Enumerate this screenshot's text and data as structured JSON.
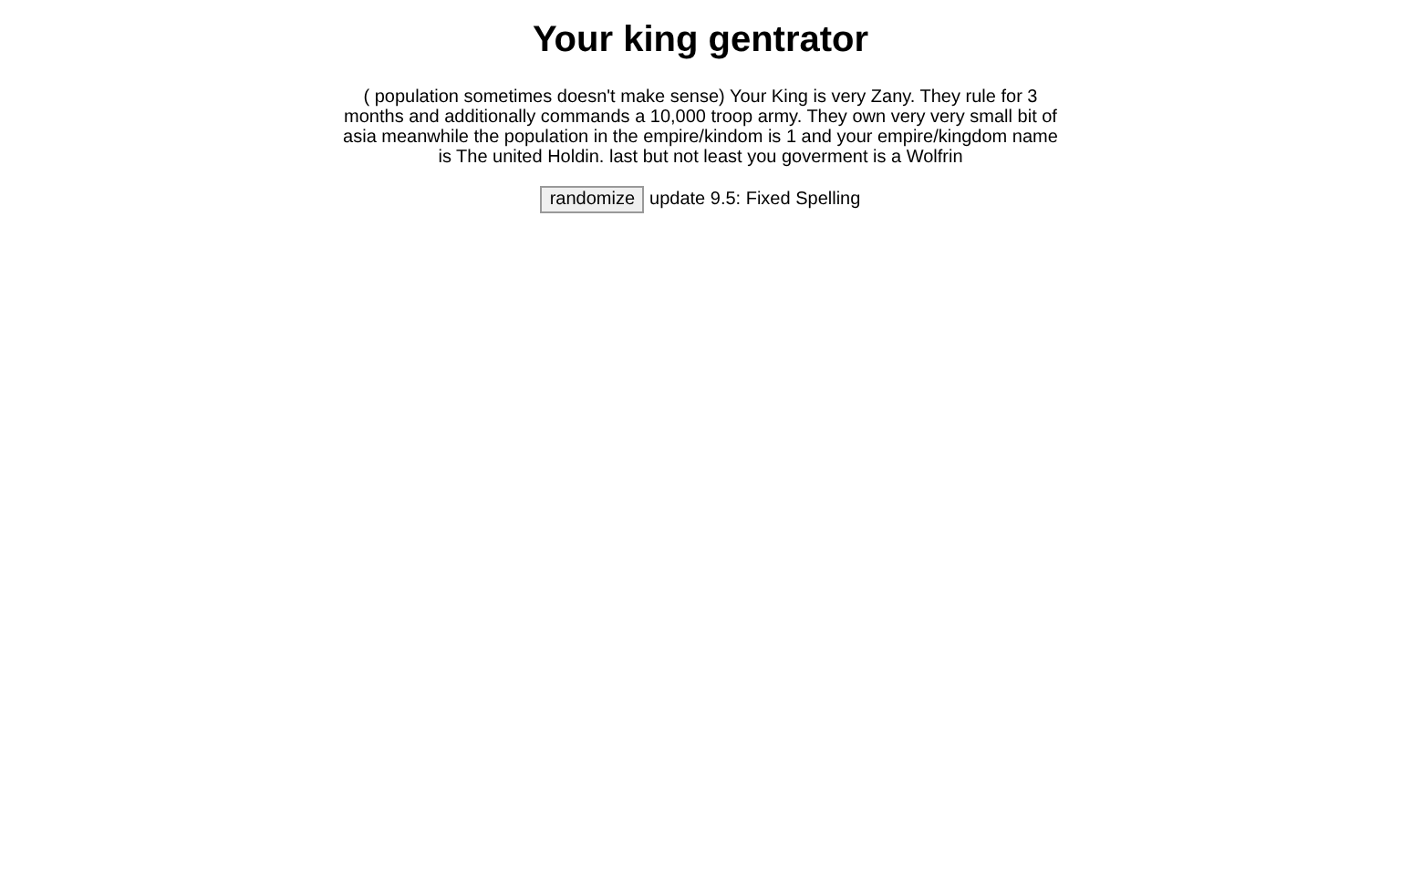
{
  "title": "Your king gentrator",
  "description": "( population sometimes doesn't make sense) Your King is very Zany. They rule for 3 months and additionally commands a 10,000 troop army. They own very very small bit of asia meanwhile the population in the empire/kindom is 1 and your empire/kingdom name is The united Holdin. last but not least you goverment is a Wolfrin",
  "button": "randomize",
  "update_note": "update 9.5: Fixed Spelling"
}
